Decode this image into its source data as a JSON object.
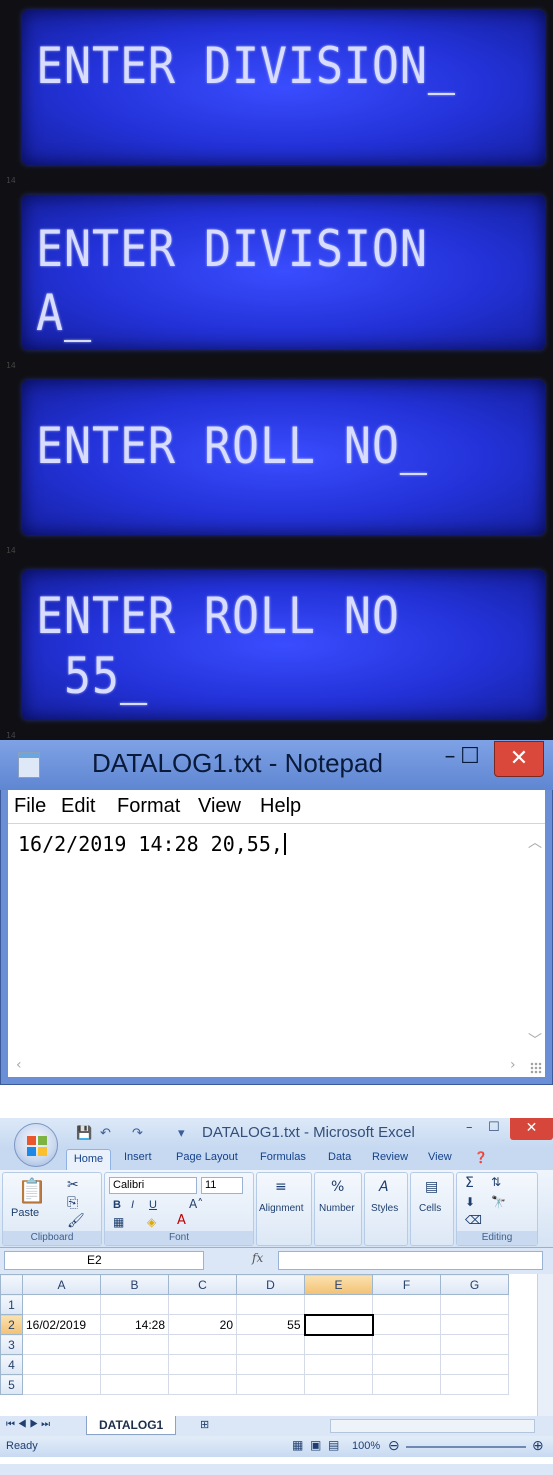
{
  "lcd": {
    "panels": [
      {
        "line1": "ENTER DIVISION_",
        "line2": ""
      },
      {
        "line1": "ENTER DIVISION",
        "line2": "A_"
      },
      {
        "line1": "ENTER ROLL NO_",
        "line2": ""
      },
      {
        "line1": "ENTER ROLL NO",
        "line2": " 55_"
      }
    ],
    "pcb_label": "14"
  },
  "notepad": {
    "title": "DATALOG1.txt - Notepad",
    "menu": [
      "File",
      "Edit",
      "Format",
      "View",
      "Help"
    ],
    "content": "16/2/2019 14:28 20,55,",
    "close_symbol": "✕",
    "min_symbol": "–",
    "max_symbol": "☐"
  },
  "excel": {
    "title": "DATALOG1.txt - Microsoft Excel",
    "tabs": [
      "Home",
      "Insert",
      "Page Layout",
      "Formulas",
      "Data",
      "Review",
      "View"
    ],
    "ribbon": {
      "clipboard": {
        "label": "Clipboard",
        "paste": "Paste"
      },
      "font": {
        "label": "Font",
        "name": "Calibri",
        "size": "11",
        "bold": "B",
        "italic": "I",
        "underline": "U"
      },
      "alignment": "Alignment",
      "number": "Number",
      "number_icon": "%",
      "styles": "Styles",
      "cells": "Cells",
      "editing": "Editing",
      "sigma": "Σ"
    },
    "name_box": "E2",
    "fx": "fx",
    "columns": [
      "A",
      "B",
      "C",
      "D",
      "E",
      "F",
      "G"
    ],
    "rows": [
      {
        "num": "1",
        "cells": [
          "",
          "",
          "",
          "",
          "",
          "",
          ""
        ]
      },
      {
        "num": "2",
        "cells": [
          "16/02/2019",
          "14:28",
          "20",
          "55",
          "",
          "",
          ""
        ]
      },
      {
        "num": "3",
        "cells": [
          "",
          "",
          "",
          "",
          "",
          "",
          ""
        ]
      },
      {
        "num": "4",
        "cells": [
          "",
          "",
          "",
          "",
          "",
          "",
          ""
        ]
      },
      {
        "num": "5",
        "cells": [
          "",
          "",
          "",
          "",
          "",
          "",
          ""
        ]
      }
    ],
    "sheet_tab": "DATALOG1",
    "status": "Ready",
    "zoom": "100%"
  }
}
